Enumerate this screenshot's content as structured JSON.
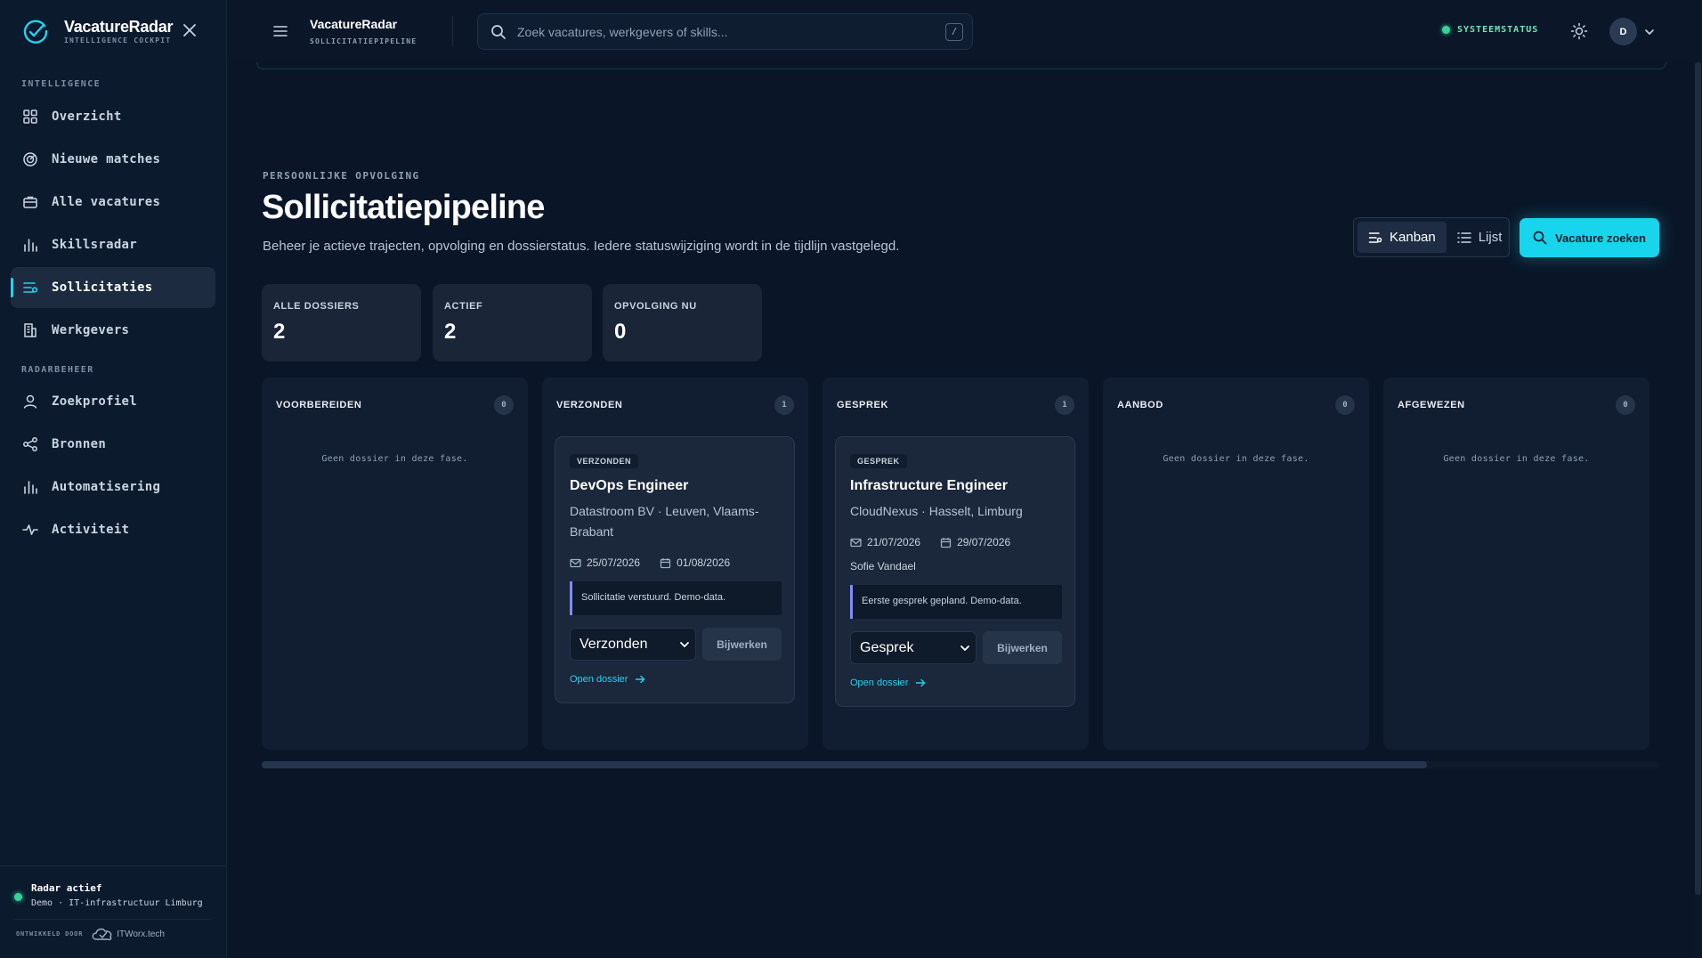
{
  "app": {
    "name": "VacatureRadar",
    "tagline": "INTELLIGENCE COCKPIT",
    "accent": "#22d3ee"
  },
  "sidebar": {
    "groups": [
      {
        "label": "INTELLIGENCE",
        "items": [
          {
            "label": "Overzicht",
            "icon": "grid-icon"
          },
          {
            "label": "Nieuwe matches",
            "icon": "radar-icon"
          },
          {
            "label": "Alle vacatures",
            "icon": "briefcase-icon"
          },
          {
            "label": "Skillsradar",
            "icon": "bar-chart-icon"
          },
          {
            "label": "Sollicitaties",
            "icon": "pipeline-icon",
            "active": true
          },
          {
            "label": "Werkgevers",
            "icon": "building-icon"
          }
        ]
      },
      {
        "label": "RADARBEHEER",
        "items": [
          {
            "label": "Zoekprofiel",
            "icon": "user-icon"
          },
          {
            "label": "Bronnen",
            "icon": "share-icon"
          },
          {
            "label": "Automatisering",
            "icon": "bar-chart-icon"
          },
          {
            "label": "Activiteit",
            "icon": "activity-icon"
          }
        ]
      }
    ],
    "radar": {
      "title": "Radar actief",
      "subtitle": "Demo · IT-infrastructuur Limburg"
    },
    "developer": {
      "label": "ONTWIKKELD DOOR",
      "name": "ITWorx.tech"
    }
  },
  "topbar": {
    "title": "VacatureRadar",
    "subtitle": "SOLLICITATIEPIPELINE",
    "search_placeholder": "Zoek vacatures, werkgevers of skills...",
    "search_shortcut": "/",
    "system_status": "SYSTEEMSTATUS",
    "avatar_initial": "D"
  },
  "header": {
    "eyebrow": "PERSOONLIJKE OPVOLGING",
    "title": "Sollicitatiepipeline",
    "description": "Beheer je actieve trajecten, opvolging en dossierstatus. Iedere statuswijziging wordt in de tijdlijn vastgelegd.",
    "view_kanban": "Kanban",
    "view_list": "Lijst",
    "cta": "Vacature zoeken"
  },
  "stats": [
    {
      "label": "ALLE DOSSIERS",
      "value": "2"
    },
    {
      "label": "ACTIEF",
      "value": "2"
    },
    {
      "label": "OPVOLGING NU",
      "value": "0"
    }
  ],
  "kanban": {
    "empty_text": "Geen dossier in deze fase.",
    "columns": [
      {
        "label": "VOORBEREIDEN",
        "count": "0"
      },
      {
        "label": "VERZONDEN",
        "count": "1",
        "card": {
          "badge": "VERZONDEN",
          "title": "DevOps Engineer",
          "company": "Datastroom BV · Leuven, Vlaams-Brabant",
          "sent_date": "25/07/2026",
          "followup_date": "01/08/2026",
          "contact": "",
          "note": "Sollicitatie verstuurd. Demo-data.",
          "status": "Verzonden",
          "update_label": "Bijwerken",
          "link_label": "Open dossier"
        }
      },
      {
        "label": "GESPREK",
        "count": "1",
        "card": {
          "badge": "GESPREK",
          "title": "Infrastructure Engineer",
          "company": "CloudNexus · Hasselt, Limburg",
          "sent_date": "21/07/2026",
          "followup_date": "29/07/2026",
          "contact": "Sofie Vandael",
          "note": "Eerste gesprek gepland. Demo-data.",
          "status": "Gesprek",
          "update_label": "Bijwerken",
          "link_label": "Open dossier"
        }
      },
      {
        "label": "AANBOD",
        "count": "0"
      },
      {
        "label": "AFGEWEZEN",
        "count": "0"
      }
    ],
    "status_options": [
      "Voorbereiden",
      "Verzonden",
      "Gesprek",
      "Aanbod",
      "Afgewezen"
    ]
  }
}
